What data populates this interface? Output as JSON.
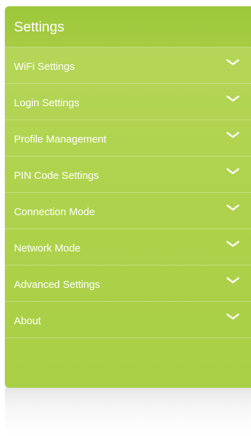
{
  "settings": {
    "title": "Settings",
    "items": [
      {
        "label": "WiFi Settings"
      },
      {
        "label": "Login Settings"
      },
      {
        "label": "Profile Management"
      },
      {
        "label": "PIN Code Settings"
      },
      {
        "label": "Connection Mode"
      },
      {
        "label": "Network Mode"
      },
      {
        "label": "Advanced Settings"
      },
      {
        "label": "About"
      }
    ],
    "item_icon": "chevron-down-icon"
  },
  "colors": {
    "panel": "#aed24b",
    "header": "#a0c83d",
    "text": "#ffffff"
  }
}
